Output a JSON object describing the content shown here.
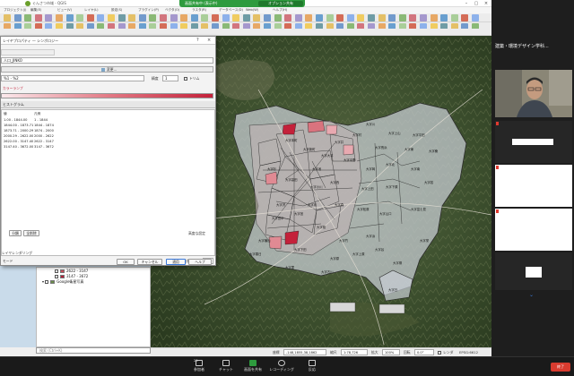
{
  "qgis": {
    "window_title": "ぐんさつ市域 - QGIS",
    "share_banner_text": "画面共有中 (表示中)",
    "share_options_label": "オプション共有",
    "menu": [
      "プロジェクト(J)",
      "編集(E)",
      "ビュー(V)",
      "レイヤ(L)",
      "設定(S)",
      "プラグイン(P)",
      "ベクタ(O)",
      "ラスタ(R)",
      "データベース(D)",
      "Web(W)",
      "ヘルプ(H)"
    ]
  },
  "dialog": {
    "title": "レイヤプロパティ — シンボロジー",
    "help_icon": "?",
    "close_icon": "×",
    "value_field": "人口_JINKO",
    "symbol_label": "変更...",
    "legend_format": "%1 - %2",
    "precision_label": "精度",
    "precision_value": "1",
    "trim_label": "トリム",
    "color_ramp_label": "カラーランプ",
    "tab_label": "ヒストグラム",
    "columns": [
      "値",
      "凡例"
    ],
    "classes": [
      {
        "value": "1.00 - 1844.00",
        "legend": "1 - 1844"
      },
      {
        "value": "1844.00 - 1873.71",
        "legend": "1844 - 1874"
      },
      {
        "value": "1873.71 - 2000.29",
        "legend": "1874 - 2000"
      },
      {
        "value": "2000.29 - 2622.00",
        "legend": "2000 - 2622"
      },
      {
        "value": "2622.00 - 3147.40",
        "legend": "2622 - 3147"
      },
      {
        "value": "3147.40 - 3672.00",
        "legend": "3147 - 3672"
      }
    ],
    "mode_label": "モード",
    "classes_count_label": "分類数",
    "classes_count": "7",
    "classify_button": "分類",
    "delete_all_button": "全削除",
    "advanced_label": "高度な設定",
    "layer_render_label": "レイヤレンダリング",
    "ok": "OK",
    "cancel": "キャンセル",
    "apply": "適用",
    "help": "ヘルプ"
  },
  "layers": [
    {
      "name": "2622 - 3147",
      "color": "#c94e5a"
    },
    {
      "name": "3147 - 3672",
      "color": "#b0213a"
    },
    {
      "name": "Google衛星写真",
      "color": "#6a8d4a"
    }
  ],
  "locator_placeholder": "検索 (Ctrl+K)",
  "status": {
    "coord_label": "座標",
    "coord_value": "-148,1855,38,1862",
    "scale_label": "縮尺",
    "scale_value": "1:78,726",
    "magnifier_label": "拡大",
    "magnifier_value": "100%",
    "rotation_label": "回転",
    "rotation_value": "0.0°",
    "render_label": "レンダ",
    "crs": "EPSG:6612"
  },
  "gallery": {
    "title": "建築・環境デザイン学科...",
    "tiles": 4
  },
  "zoom_toolbar": [
    {
      "label": "参加者",
      "icon": "participants-icon"
    },
    {
      "label": "チャット",
      "icon": "chat-icon"
    },
    {
      "label": "画面を共有",
      "icon": "share-screen-icon"
    },
    {
      "label": "レコーディング",
      "icon": "record-icon"
    },
    {
      "label": "反応",
      "icon": "reactions-icon"
    }
  ],
  "participants_count": "23",
  "end_label": "終了",
  "map_labels": [
    "大字川",
    "大字上山",
    "大字平田",
    "大字長浜",
    "大字東",
    "大字中野",
    "大字岡",
    "大字北",
    "大字南",
    "大字西",
    "大字上田",
    "大字下原",
    "大字本町",
    "大字新町",
    "大字大平",
    "大字杉",
    "大字高田",
    "大字小川",
    "大字森",
    "大字松原",
    "大字山口",
    "大字富士見",
    "大字沢",
    "大字宮",
    "大字桜",
    "大字竹",
    "大字浜",
    "大字原",
    "大字上原",
    "大字下田",
    "大字田中",
    "大字横山",
    "大字池",
    "大字井",
    "大字村",
    "大字里",
    "大字谷",
    "大字柳",
    "大字若",
    "大字桑",
    "大字古川",
    "大字春日",
    "大字栄",
    "大字日",
    "大字月"
  ]
}
